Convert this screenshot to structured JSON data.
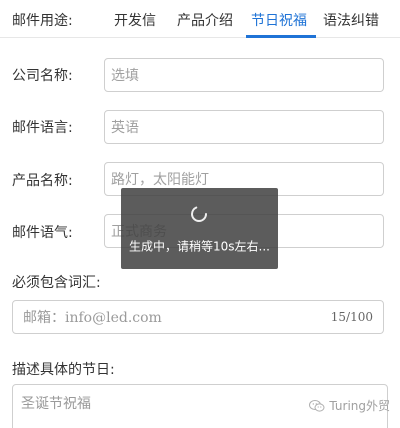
{
  "tabs": {
    "label": "邮件用途:",
    "items": [
      {
        "label": "开发信",
        "active": false
      },
      {
        "label": "产品介绍",
        "active": false
      },
      {
        "label": "节日祝福",
        "active": true
      },
      {
        "label": "语法纠错",
        "active": false
      }
    ],
    "accent_color": "#1f73d6"
  },
  "form": {
    "company": {
      "label": "公司名称:",
      "placeholder": "选填"
    },
    "language": {
      "label": "邮件语言:",
      "value": "英语"
    },
    "product": {
      "label": "产品名称:",
      "value": "路灯，太阳能灯"
    },
    "tone": {
      "label": "邮件语气:",
      "value": "正式商务"
    },
    "keywords": {
      "label": "必须包含词汇:",
      "placeholder": "邮箱：info@led.com",
      "counter": "15/100"
    },
    "holiday": {
      "label": "描述具体的节日:",
      "placeholder": "圣诞节祝福"
    }
  },
  "loading": {
    "text": "生成中，请稍等10s左右..."
  },
  "watermark": {
    "text": "Turing外贸",
    "icon": "wechat-icon"
  }
}
